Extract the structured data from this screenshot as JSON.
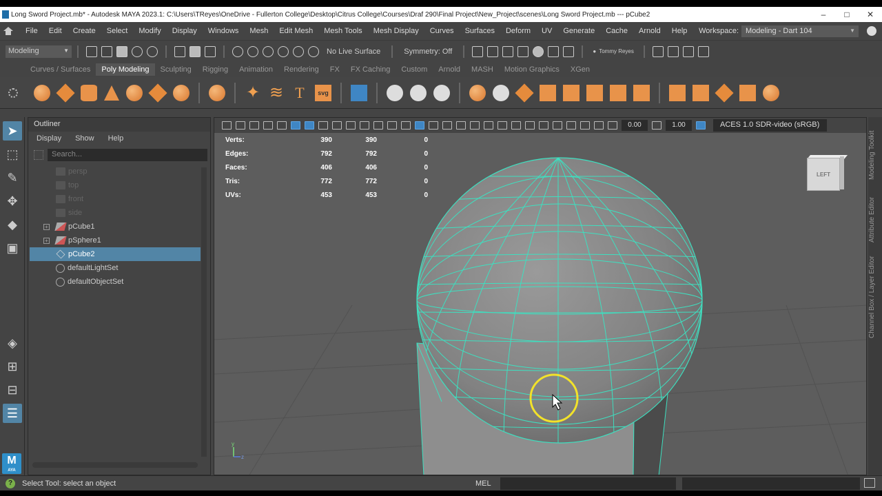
{
  "window": {
    "title": "Long Sword Project.mb* - Autodesk MAYA 2023.1: C:\\Users\\TReyes\\OneDrive - Fullerton College\\Desktop\\Citrus College\\Courses\\Draf 290\\Final Project\\New_Project\\scenes\\Long Sword Project.mb  ---  pCube2",
    "controls": [
      "–",
      "□",
      "✕"
    ]
  },
  "menubar": {
    "items": [
      "File",
      "Edit",
      "Create",
      "Select",
      "Modify",
      "Display",
      "Windows",
      "Mesh",
      "Edit Mesh",
      "Mesh Tools",
      "Mesh Display",
      "Curves",
      "Surfaces",
      "Deform",
      "UV",
      "Generate",
      "Cache",
      "Arnold",
      "Help"
    ],
    "workspace_label": "Workspace:",
    "workspace_value": "Modeling - Dart 104"
  },
  "statusline": {
    "mode": "Modeling",
    "live_surface": "No Live Surface",
    "symmetry": "Symmetry: Off",
    "user": "Tommy Reyes"
  },
  "shelf": {
    "tabs": [
      "Curves / Surfaces",
      "Poly Modeling",
      "Sculpting",
      "Rigging",
      "Animation",
      "Rendering",
      "FX",
      "FX Caching",
      "Custom",
      "Arnold",
      "MASH",
      "Motion Graphics",
      "XGen"
    ],
    "active_tab": "Poly Modeling",
    "svg_label": "svg",
    "text_label": "T"
  },
  "outliner": {
    "tab": "Outliner",
    "menu": [
      "Display",
      "Show",
      "Help"
    ],
    "search_placeholder": "Search...",
    "items": [
      {
        "label": "persp",
        "icon": "camera-icon",
        "dim": true
      },
      {
        "label": "top",
        "icon": "camera-icon",
        "dim": true
      },
      {
        "label": "front",
        "icon": "camera-icon",
        "dim": true
      },
      {
        "label": "side",
        "icon": "camera-icon",
        "dim": true
      },
      {
        "label": "pCube1",
        "icon": "mesh-icon",
        "expand": true
      },
      {
        "label": "pSphere1",
        "icon": "mesh-icon",
        "expand": true
      },
      {
        "label": "pCube2",
        "icon": "cube-icon",
        "selected": true
      },
      {
        "label": "defaultLightSet",
        "icon": "set-icon"
      },
      {
        "label": "defaultObjectSet",
        "icon": "set-icon"
      }
    ]
  },
  "viewport": {
    "near_clip": "0.00",
    "far_clip": "1.00",
    "color_space": "ACES 1.0 SDR-video (sRGB)",
    "viewcube_label": "LEFT",
    "hud": [
      {
        "label": "Verts:",
        "a": "390",
        "b": "390",
        "c": "0"
      },
      {
        "label": "Edges:",
        "a": "792",
        "b": "792",
        "c": "0"
      },
      {
        "label": "Faces:",
        "a": "406",
        "b": "406",
        "c": "0"
      },
      {
        "label": "Tris:",
        "a": "772",
        "b": "772",
        "c": "0"
      },
      {
        "label": "UVs:",
        "a": "453",
        "b": "453",
        "c": "0"
      }
    ],
    "axis_y": "y",
    "axis_z": "z"
  },
  "side_tabs": [
    "Modeling Toolkit",
    "Attribute Editor",
    "Channel Box / Layer Editor"
  ],
  "bottombar": {
    "help_text": "Select Tool: select an object",
    "script_lang": "MEL"
  },
  "colors": {
    "wireframe": "#3de0c0",
    "selection": "#5285a6",
    "shelf_orange": "#e8934a",
    "cursor_ring": "#f2e22a"
  }
}
